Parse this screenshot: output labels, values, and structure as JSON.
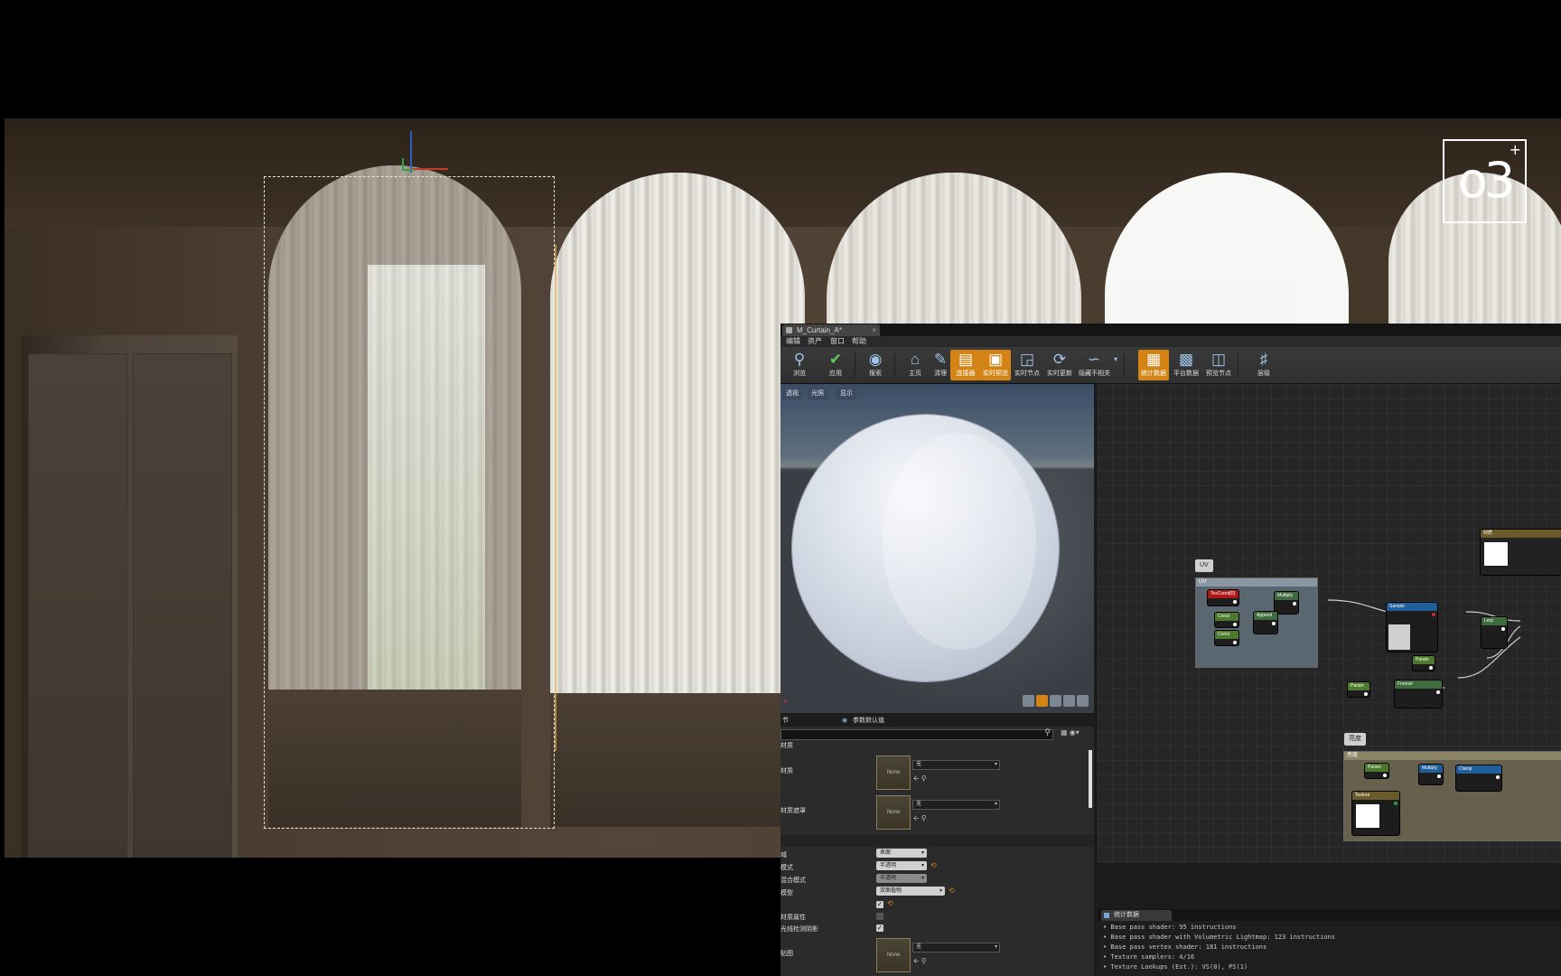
{
  "logo": {
    "text": "o3",
    "mark": "+"
  },
  "editor": {
    "tab_title": "M_Curtain_A*",
    "tab_close": "×",
    "menu": [
      "编辑",
      "资产",
      "窗口",
      "帮助"
    ],
    "toolbar": [
      {
        "label": "浏览",
        "icon": "magnifier-icon"
      },
      {
        "label": "应用",
        "icon": "checkmark-icon"
      },
      {
        "label": "搜索",
        "icon": "binoculars-icon"
      },
      {
        "label": "主页",
        "icon": "home-icon"
      },
      {
        "label": "清理",
        "icon": "broom-icon"
      },
      {
        "label": "连接器",
        "icon": "connector-icon"
      },
      {
        "label": "实时预览",
        "icon": "monitor-icon"
      },
      {
        "label": "实时节点",
        "icon": "live-node-icon"
      },
      {
        "label": "实时更新",
        "icon": "refresh-icon"
      },
      {
        "label": "隐藏不相关",
        "icon": "curve-icon"
      },
      {
        "label": "统计数据",
        "icon": "stats-icon"
      },
      {
        "label": "平台数据",
        "icon": "platform-icon"
      },
      {
        "label": "预览节点",
        "icon": "preview-node-icon"
      },
      {
        "label": "层级",
        "icon": "hierarchy-icon"
      }
    ],
    "viewport": {
      "buttons": [
        "透视",
        "光照",
        "显示"
      ],
      "axis": "Y"
    },
    "details": {
      "tab_left": "节",
      "tab_params": "参数默认值",
      "section_material": "材质",
      "rows": [
        {
          "label": "材质",
          "thumb": "None",
          "combo": "无"
        },
        {
          "label": "材质遮罩",
          "thumb": "None",
          "combo": "无"
        }
      ],
      "props": [
        {
          "label": "域",
          "value": "表面"
        },
        {
          "label": "模式",
          "value": "半透明"
        },
        {
          "label": "混合模式",
          "value": "半透明"
        },
        {
          "label": "模型",
          "value": "双面植物"
        }
      ],
      "checks": [
        {
          "label": "",
          "checked": true
        },
        {
          "label": "材质属性",
          "checked": false
        },
        {
          "label": "光线检测阴影",
          "checked": true
        }
      ],
      "last_row": {
        "label": "贴图",
        "thumb": "None",
        "combo": "无"
      }
    },
    "graph": {
      "comment_uv": "UV",
      "comment_uv_box": "UV",
      "comment_bright": "亮度",
      "comment_bright_box": "亮度",
      "nodes": {
        "texcoord": "TexCoord[0]",
        "multiply1": "Multiply",
        "const1": "Const",
        "const2": "Const",
        "append": "Append",
        "sample": "Sample",
        "fresnel": "Fresnel",
        "lerp": "Lerp",
        "param1": "Param",
        "param2": "Param",
        "multiply2": "Multiply",
        "clamp": "Clamp",
        "bright_tex": "Texture",
        "output": "材质"
      }
    },
    "stats": {
      "tab": "统计数据",
      "lines": [
        "• Base pass shader: 95 instructions",
        "• Base pass shader with Volumetric Lightmap: 123 instructions",
        "• Base pass vertex shader: 181 instructions",
        "• Texture samplers: 4/16",
        "• Texture Lookups (Est.): VS(0), PS(1)"
      ]
    }
  }
}
